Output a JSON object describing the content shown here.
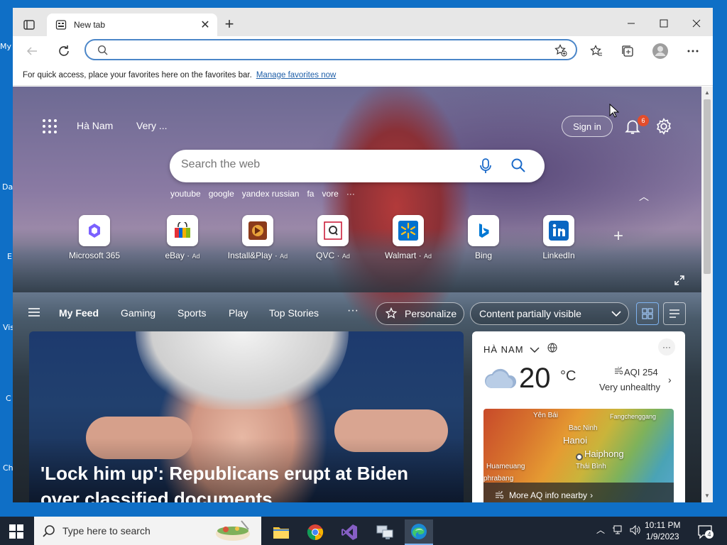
{
  "desktop": {
    "labels": [
      "My",
      "Da",
      "E",
      "Vis",
      "C",
      "Ch"
    ]
  },
  "browser": {
    "tab_title": "New tab",
    "address_placeholder": "",
    "favorites_bar": {
      "message": "For quick access, place your favorites here on the favorites bar.",
      "link": "Manage favorites now"
    }
  },
  "ntp": {
    "location": "Hà Nam",
    "weather_short": "Very ...",
    "sign_in": "Sign in",
    "notification_count": "6",
    "search_placeholder": "Search the web",
    "trending": [
      "youtube",
      "google",
      "yandex russian",
      "fa",
      "vore",
      "···"
    ],
    "quick_links": [
      {
        "name": "Microsoft 365",
        "ad": "",
        "icon": "microsoft-365-icon",
        "color": "#7b61ff"
      },
      {
        "name": "eBay",
        "ad": "Ad",
        "icon": "ebay-icon",
        "color": "#e53238"
      },
      {
        "name": "Install&Play",
        "ad": "Ad",
        "icon": "install-play-icon",
        "color": "#b5651d"
      },
      {
        "name": "QVC",
        "ad": "Ad",
        "icon": "qvc-icon",
        "color": "#c8102e"
      },
      {
        "name": "Walmart",
        "ad": "Ad",
        "icon": "walmart-icon",
        "color": "#0071ce"
      },
      {
        "name": "Bing",
        "ad": "",
        "icon": "bing-icon",
        "color": "#0078d4"
      },
      {
        "name": "LinkedIn",
        "ad": "",
        "icon": "linkedin-icon",
        "color": "#0a66c2"
      }
    ],
    "feed_tabs": [
      "My Feed",
      "Gaming",
      "Sports",
      "Play",
      "Top Stories"
    ],
    "feed_more": "···",
    "personalize": "Personalize",
    "content_visibility": "Content partially visible",
    "hero_headline": "'Lock him up': Republicans erupt at Biden over classified documents",
    "weather": {
      "location": "HÀ NAM",
      "temperature": "20",
      "unit": "°C",
      "aqi": "AQI 254",
      "aqi_status": "Very unhealthy",
      "map_labels": [
        "Yên Bái",
        "Fangchenggang",
        "Bac Ninh",
        "Hanoi",
        "Haiphong",
        "Huameuang",
        "Thái Bình",
        "phrabang"
      ],
      "more_link": "More AQ info nearby"
    }
  },
  "taskbar": {
    "search_placeholder": "Type here to search",
    "time": "10:11 PM",
    "date": "1/9/2023",
    "notification_count": "4"
  },
  "colors": {
    "accent": "#4b86c8",
    "desktop": "#0f6fc6",
    "taskbar": "#1c2533",
    "badge": "#e34d2b"
  }
}
